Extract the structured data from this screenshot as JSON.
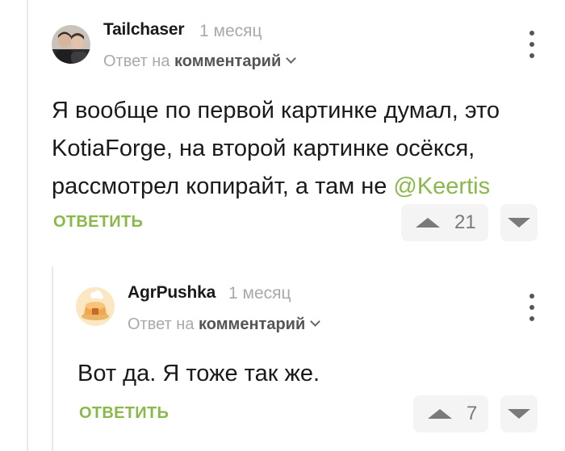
{
  "comments": [
    {
      "author": "Tailchaser",
      "time": "1 месяц",
      "reply_prefix": "Ответ на",
      "reply_target": "комментарий",
      "text_lines": [
        "Я вообще по первой картинке думал, это",
        "KotiaForge, на второй картинке осёкся,",
        "рассмотрел копирайт, а там не "
      ],
      "mention": "@Keertis",
      "reply_label": "ОТВЕТИТЬ",
      "rating": "21",
      "avatar_icon": "user-photo-avatar"
    },
    {
      "author": "AgrPushka",
      "time": "1 месяц",
      "reply_prefix": "Ответ на",
      "reply_target": "комментарий",
      "text_lines": [
        "Вот да. Я тоже так же."
      ],
      "reply_label": "ОТВЕТИТЬ",
      "rating": "7",
      "avatar_icon": "pie-avatar"
    }
  ],
  "colors": {
    "accent": "#8ab84a",
    "muted": "#a9a9a9",
    "vote_bg": "#f4f4f4",
    "vote_icon": "#7a7a7a"
  }
}
